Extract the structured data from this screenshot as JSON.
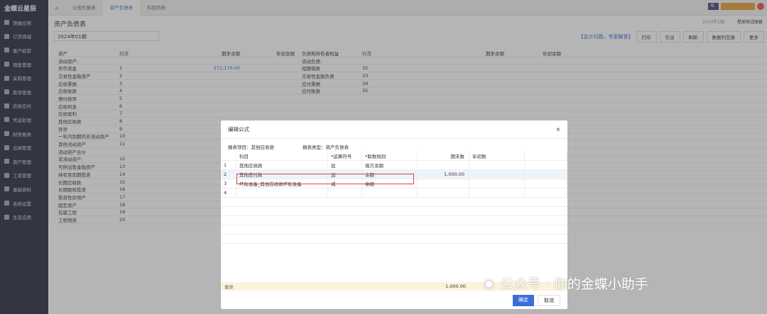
{
  "app": {
    "logo": "金蝶云星辰"
  },
  "sidebar": [
    "快捷应用",
    "订货商城",
    "客户经营",
    "销售管理",
    "采购管理",
    "库存管理",
    "应收应付",
    "凭证处理",
    "财务报表",
    "出纳管理",
    "资产管理",
    "工资管理",
    "基础资料",
    "系统设置",
    "生态应用"
  ],
  "tabs": [
    "公告栏报表",
    "资产负债表",
    "科目列表"
  ],
  "header": {
    "period_info": "2024年1期",
    "account": "星辰测试账套"
  },
  "page": {
    "title": "资产负债表",
    "period": "2024年01期",
    "help_link": "【会计问题，专家解答】",
    "print": "打印",
    "export": "引出",
    "refresh": "刷新",
    "check": "数据列互换",
    "more": "更多"
  },
  "table": {
    "headers": [
      "资产",
      "行次",
      "期末余额",
      "年初余额",
      "负债和所有者权益",
      "行次",
      "期末余额",
      "年初余额"
    ],
    "left": [
      [
        "流动资产:",
        "",
        ""
      ],
      [
        "货币资金",
        "1",
        "572,179.00"
      ],
      [
        "交易性金融资产",
        "2",
        ""
      ],
      [
        "应收票据",
        "3",
        ""
      ],
      [
        "应收账款",
        "4",
        ""
      ],
      [
        "预付款项",
        "5",
        ""
      ],
      [
        "应收利息",
        "6",
        ""
      ],
      [
        "应收股利",
        "7",
        ""
      ],
      [
        "其他应收款",
        "8",
        ""
      ],
      [
        "存货",
        "9",
        ""
      ],
      [
        "一年内到期的非流动资产",
        "10",
        ""
      ],
      [
        "其他流动资产",
        "11",
        ""
      ],
      [
        "流动资产合计",
        "",
        ""
      ],
      [
        "非流动资产:",
        "12",
        ""
      ],
      [
        "可供出售金融资产",
        "13",
        ""
      ],
      [
        "持有至到期投资",
        "14",
        ""
      ],
      [
        "长期应收款",
        "15",
        ""
      ],
      [
        "长期股权投资",
        "16",
        ""
      ],
      [
        "投资性房地产",
        "17",
        ""
      ],
      [
        "固定资产",
        "18",
        ""
      ],
      [
        "在建工程",
        "19",
        ""
      ],
      [
        "工程物资",
        "20",
        ""
      ]
    ],
    "right": [
      [
        "流动负债:",
        ""
      ],
      [
        "短期借款",
        "32"
      ],
      [
        "交易性金融负债",
        "33"
      ],
      [
        "应付票据",
        "34"
      ],
      [
        "应付账款",
        "35"
      ]
    ]
  },
  "modal": {
    "title": "编辑公式",
    "item_label": "报表项目：",
    "item": "其他应收款",
    "type_label": "报表类型：",
    "type": "资产负债表",
    "headers": [
      "科目",
      "*运算符号",
      "*取数规则",
      "期末数",
      "年初数"
    ],
    "rows": [
      [
        "1",
        "其他应收款",
        "加",
        "借方余额",
        ""
      ],
      [
        "2",
        "其他应付款",
        "加",
        "余额",
        "1,000.00"
      ],
      [
        "3",
        "坏账准备_其他应收款坏账准备",
        "减",
        "余额",
        ""
      ],
      [
        "4",
        "",
        "",
        "",
        ""
      ]
    ],
    "total_label": "合计",
    "total": "1,000.00",
    "ok": "确定",
    "cancel": "取消"
  },
  "watermark": "公众号 · 你的金蝶小助手"
}
